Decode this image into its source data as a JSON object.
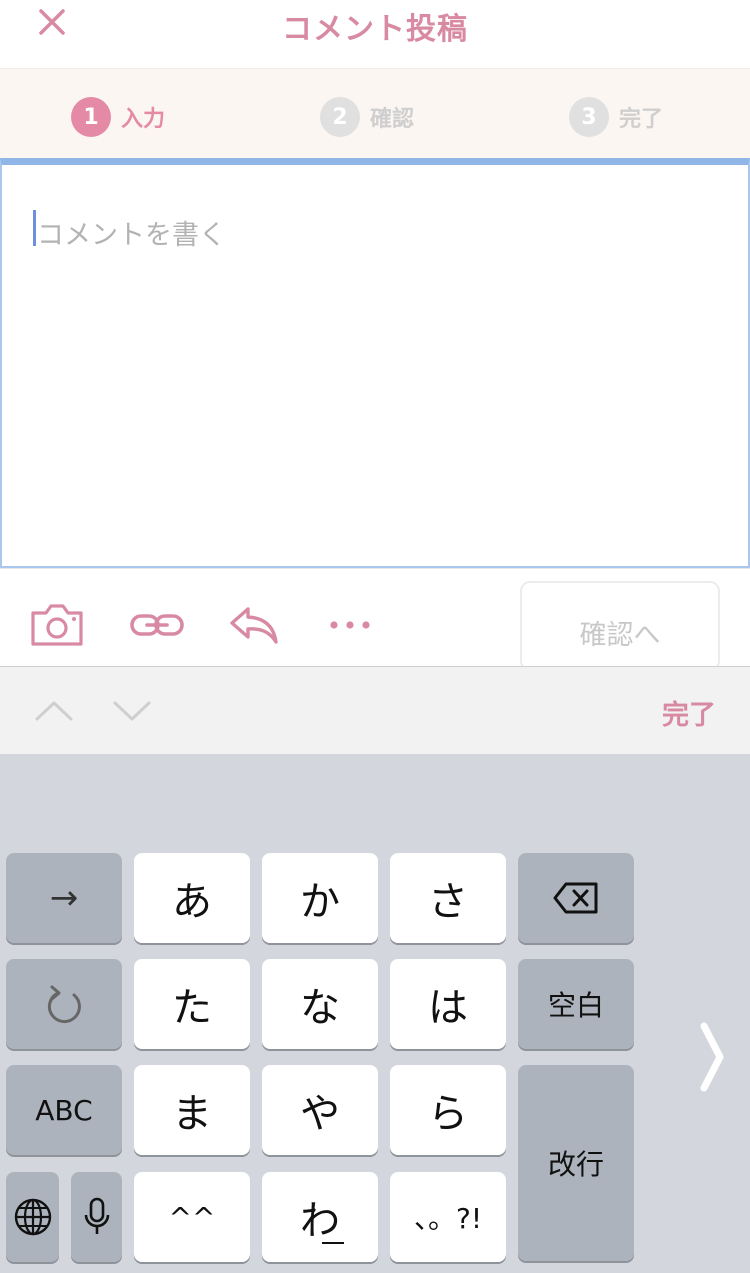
{
  "header": {
    "title": "コメント投稿",
    "close_icon": "close-icon"
  },
  "steps": [
    {
      "number": "1",
      "label": "入力",
      "active": true
    },
    {
      "number": "2",
      "label": "確認",
      "active": false
    },
    {
      "number": "3",
      "label": "完了",
      "active": false
    }
  ],
  "editor": {
    "placeholder": "コメントを書く"
  },
  "toolbar": {
    "icons": [
      "camera-icon",
      "link-icon",
      "reply-icon",
      "more-icon"
    ],
    "confirm_label": "確認へ"
  },
  "accessory": {
    "done_label": "完了"
  },
  "keyboard": {
    "row1": [
      "→",
      "あ",
      "か",
      "さ",
      "delete-icon"
    ],
    "row2": [
      "undo-icon",
      "た",
      "な",
      "は",
      "空白"
    ],
    "row3": [
      "ABC",
      "ま",
      "や",
      "ら",
      "改行"
    ],
    "row4": [
      "globe-icon",
      "mic-icon",
      "^^",
      "わ",
      "、。?!"
    ],
    "labels": {
      "arrow": "→",
      "a": "あ",
      "ka": "か",
      "sa": "さ",
      "ta": "た",
      "na": "な",
      "ha": "は",
      "space": "空白",
      "abc": "ABC",
      "ma": "ま",
      "ya": "や",
      "ra": "ら",
      "return": "改行",
      "emoticon": "^^",
      "wa": "わ",
      "punct": "、。?!"
    }
  },
  "colors": {
    "accent": "#d98aa3",
    "step_active": "#e58aa6",
    "focus_border": "#90b6e8",
    "keyboard_bg": "#d3d6dc"
  }
}
